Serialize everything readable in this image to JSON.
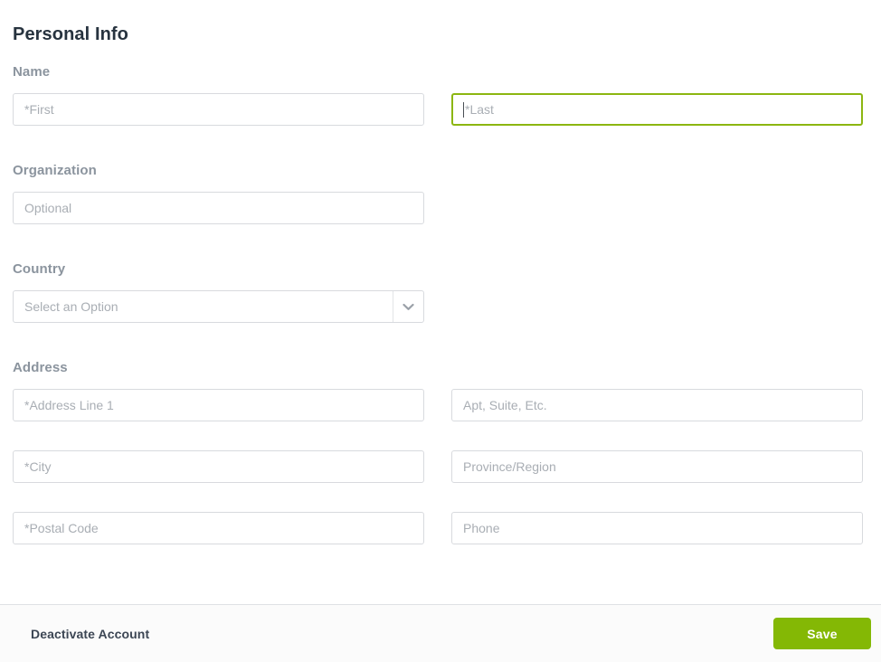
{
  "page": {
    "title": "Personal Info"
  },
  "sections": {
    "name": {
      "label": "Name"
    },
    "organization": {
      "label": "Organization"
    },
    "country": {
      "label": "Country"
    },
    "address": {
      "label": "Address"
    }
  },
  "fields": {
    "first_name": {
      "placeholder": "*First",
      "value": ""
    },
    "last_name": {
      "placeholder": "*Last",
      "value": ""
    },
    "organization": {
      "placeholder": "Optional",
      "value": ""
    },
    "country": {
      "placeholder": "Select an Option",
      "value": "",
      "arrow_icon": "chevron-down-icon"
    },
    "address_line_1": {
      "placeholder": "*Address Line 1",
      "value": ""
    },
    "apt_suite": {
      "placeholder": "Apt, Suite, Etc.",
      "value": ""
    },
    "city": {
      "placeholder": "*City",
      "value": ""
    },
    "province_region": {
      "placeholder": "Province/Region",
      "value": ""
    },
    "postal_code": {
      "placeholder": "*Postal Code",
      "value": ""
    },
    "phone": {
      "placeholder": "Phone",
      "value": ""
    }
  },
  "footer": {
    "deactivate_label": "Deactivate Account",
    "save_label": "Save"
  },
  "colors": {
    "accent_green": "#84b805",
    "focus_border": "#8cb611",
    "heading": "#27333f",
    "label": "#8b949e",
    "placeholder": "#a9aeb4",
    "field_border": "#d8dade",
    "footer_bg": "#fbfbfb"
  }
}
